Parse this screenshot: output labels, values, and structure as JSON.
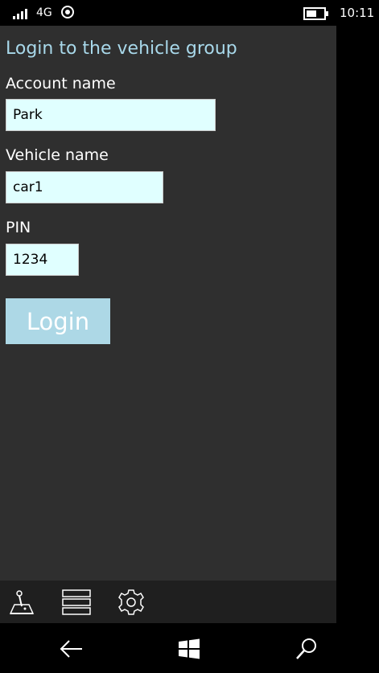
{
  "status_bar": {
    "network": "4G",
    "time": "10:11",
    "battery_level": 0.6,
    "icons": [
      "signal-icon",
      "location-icon",
      "battery-icon"
    ]
  },
  "page": {
    "title": "Login to the vehicle group"
  },
  "form": {
    "account_label": "Account name",
    "account_value": "Park",
    "vehicle_label": "Vehicle name",
    "vehicle_value": "car1",
    "pin_label": "PIN",
    "pin_value": "1234",
    "login_label": "Login"
  },
  "app_bar": {
    "items": [
      "joystick-icon",
      "list-icon",
      "gear-icon"
    ]
  },
  "nav_bar": {
    "items": [
      "back-icon",
      "windows-icon",
      "search-icon"
    ]
  },
  "colors": {
    "title": "#a8d8ea",
    "input_bg": "#e0ffff",
    "button_bg": "#add8e6",
    "page_bg": "#2f2f2f"
  }
}
